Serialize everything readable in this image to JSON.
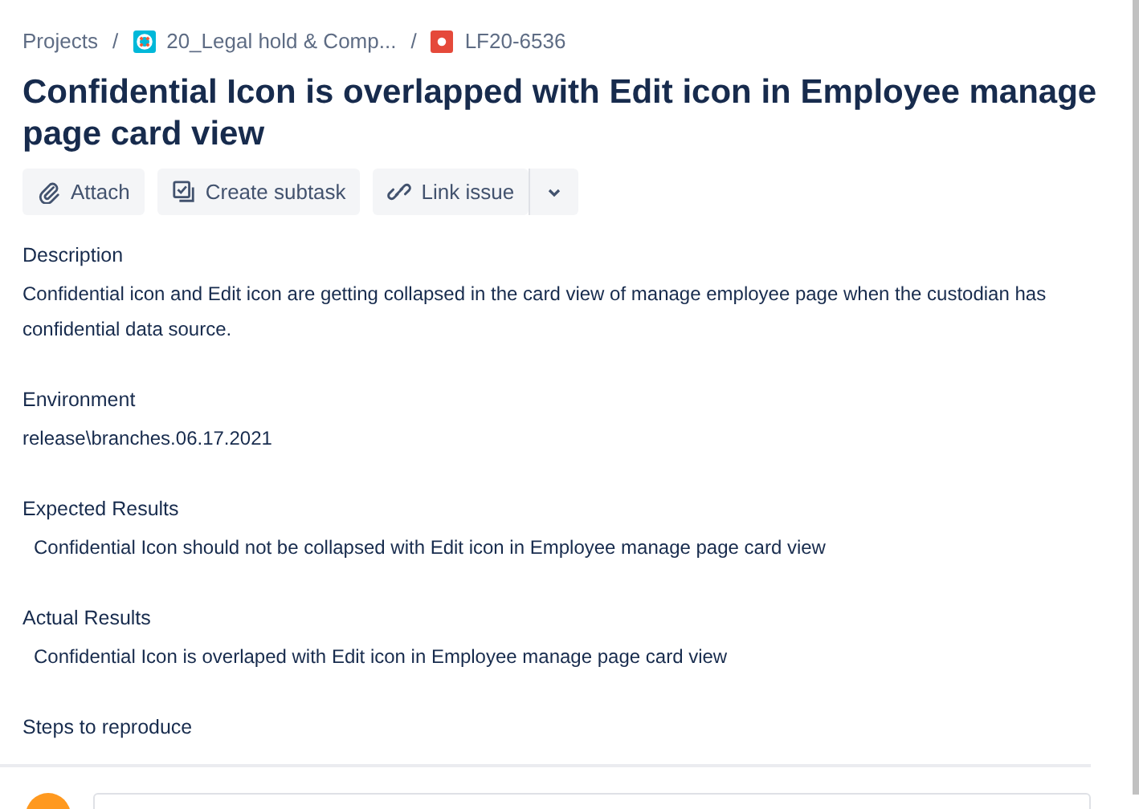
{
  "breadcrumbs": [
    {
      "label": "Projects",
      "kind": "text"
    },
    {
      "label": "20_Legal hold & Comp...",
      "kind": "project"
    },
    {
      "label": "LF20-6536",
      "kind": "issue"
    }
  ],
  "title": "Confidential Icon is overlapped with Edit icon in Employee manage page card view",
  "actions": [
    {
      "label": "Attach",
      "kind": "attach"
    },
    {
      "label": "Create subtask",
      "kind": "subtask"
    },
    {
      "label": "Link issue",
      "kind": "link"
    }
  ],
  "sections": [
    {
      "label": "Description",
      "text": "Confidential icon and Edit icon are getting collapsed in the card view of manage employee page when the custodian has confidential data source.",
      "indented": false
    },
    {
      "label": "Environment",
      "text": "release\\branches.06.17.2021",
      "indented": false
    },
    {
      "label": "Expected Results",
      "text": "Confidential Icon should not be collapsed with Edit icon in Employee manage page card view",
      "indented": true
    },
    {
      "label": "Actual Results",
      "text": "Confidential Icon is overlaped with Edit icon in Employee manage page card view",
      "indented": true
    },
    {
      "label": "Steps to reproduce"
    }
  ],
  "breadcrumb_separator": "/"
}
